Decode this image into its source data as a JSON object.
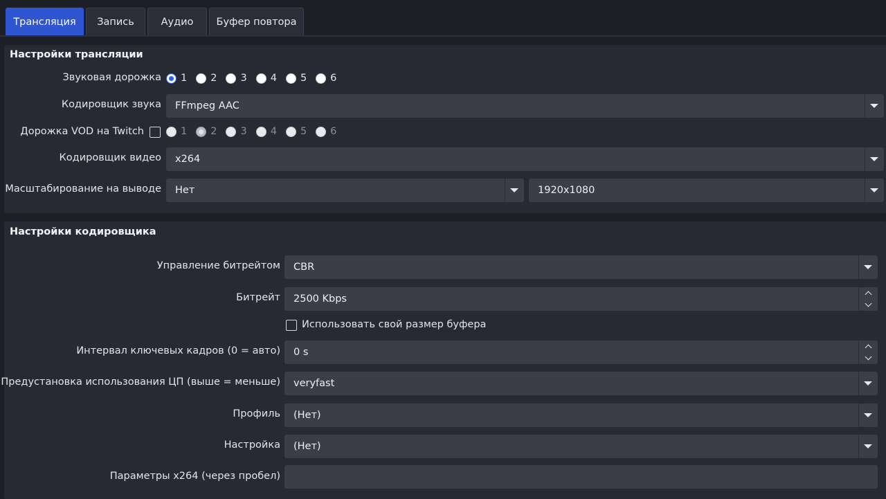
{
  "tabs": [
    {
      "label": "Трансляция",
      "active": true
    },
    {
      "label": "Запись",
      "active": false
    },
    {
      "label": "Аудио",
      "active": false
    },
    {
      "label": "Буфер повтора",
      "active": false
    }
  ],
  "stream_settings": {
    "title": "Настройки трансляции",
    "audio_track": {
      "label": "Звуковая дорожка",
      "options": [
        "1",
        "2",
        "3",
        "4",
        "5",
        "6"
      ],
      "selected": "1"
    },
    "audio_encoder": {
      "label": "Кодировщик звука",
      "value": "FFmpeg AAC"
    },
    "twitch_vod": {
      "label": "Дорожка VOD на Twitch",
      "checked": false,
      "options": [
        "1",
        "2",
        "3",
        "4",
        "5",
        "6"
      ],
      "selected": "2"
    },
    "video_encoder": {
      "label": "Кодировщик видео",
      "value": "x264"
    },
    "output_scaling": {
      "label": "Масштабирование на выводе",
      "value": "Нет",
      "resolution": "1920x1080"
    }
  },
  "encoder_settings": {
    "title": "Настройки кодировщика",
    "rate_control": {
      "label": "Управление битрейтом",
      "value": "CBR"
    },
    "bitrate": {
      "label": "Битрейт",
      "value": "2500 Kbps"
    },
    "custom_buffer": {
      "label": "Использовать свой размер буфера",
      "checked": false
    },
    "keyframe_interval": {
      "label": "Интервал ключевых кадров (0 = авто)",
      "value": "0 s"
    },
    "cpu_preset": {
      "label": "Предустановка использования ЦП (выше = меньше)",
      "value": "veryfast"
    },
    "profile": {
      "label": "Профиль",
      "value": "(Нет)"
    },
    "tune": {
      "label": "Настройка",
      "value": "(Нет)"
    },
    "x264_options": {
      "label": "Параметры x264 (через пробел)",
      "value": ""
    }
  },
  "colors": {
    "accent": "#2f56d0",
    "background": "#1d1f26",
    "panel": "#272a33",
    "field": "#3b3e48"
  }
}
